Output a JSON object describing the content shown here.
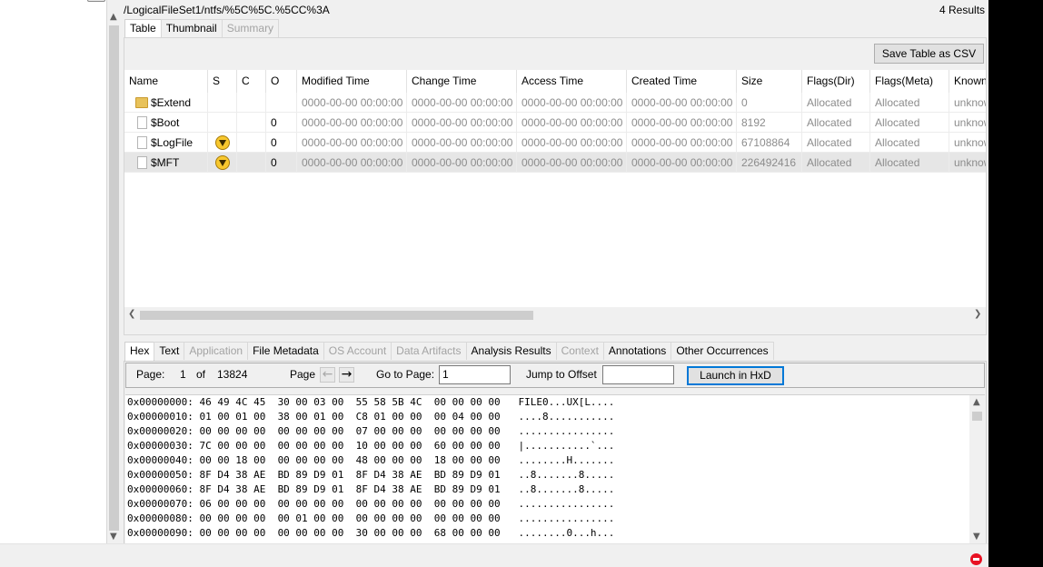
{
  "header": {
    "path": "/LogicalFileSet1/ntfs/%5C%5C.%5CC%3A",
    "results": "4  Results"
  },
  "result_tabs": [
    {
      "label": "Table",
      "state": "active"
    },
    {
      "label": "Thumbnail",
      "state": "normal"
    },
    {
      "label": "Summary",
      "state": "disabled"
    }
  ],
  "toolbar": {
    "save_csv_label": "Save Table as CSV"
  },
  "table": {
    "columns": [
      "Name",
      "S",
      "C",
      "O",
      "Modified Time",
      "Change Time",
      "Access Time",
      "Created Time",
      "Size",
      "Flags(Dir)",
      "Flags(Meta)",
      "Known"
    ],
    "rows": [
      {
        "name": "$Extend",
        "icon": "folder-icon",
        "s_icon": "",
        "c": "",
        "o": "",
        "modified": "0000-00-00 00:00:00",
        "change": "0000-00-00 00:00:00",
        "access": "0000-00-00 00:00:00",
        "created": "0000-00-00 00:00:00",
        "size": "0",
        "flags_dir": "Allocated",
        "flags_meta": "Allocated",
        "known": "unknown",
        "selected": false
      },
      {
        "name": "$Boot",
        "icon": "file-icon",
        "s_icon": "",
        "c": "",
        "o": "0",
        "modified": "0000-00-00 00:00:00",
        "change": "0000-00-00 00:00:00",
        "access": "0000-00-00 00:00:00",
        "created": "0000-00-00 00:00:00",
        "size": "8192",
        "flags_dir": "Allocated",
        "flags_meta": "Allocated",
        "known": "unknown",
        "selected": false
      },
      {
        "name": "$LogFile",
        "icon": "file-icon",
        "s_icon": "score-warning-icon",
        "c": "",
        "o": "0",
        "modified": "0000-00-00 00:00:00",
        "change": "0000-00-00 00:00:00",
        "access": "0000-00-00 00:00:00",
        "created": "0000-00-00 00:00:00",
        "size": "67108864",
        "flags_dir": "Allocated",
        "flags_meta": "Allocated",
        "known": "unknown",
        "selected": false
      },
      {
        "name": "$MFT",
        "icon": "file-icon",
        "s_icon": "score-warning-icon",
        "c": "",
        "o": "0",
        "modified": "0000-00-00 00:00:00",
        "change": "0000-00-00 00:00:00",
        "access": "0000-00-00 00:00:00",
        "created": "0000-00-00 00:00:00",
        "size": "226492416",
        "flags_dir": "Allocated",
        "flags_meta": "Allocated",
        "known": "unknown",
        "selected": true
      }
    ]
  },
  "content_tabs": [
    {
      "label": "Hex",
      "state": "active"
    },
    {
      "label": "Text",
      "state": "normal"
    },
    {
      "label": "Application",
      "state": "disabled"
    },
    {
      "label": "File Metadata",
      "state": "normal"
    },
    {
      "label": "OS Account",
      "state": "disabled"
    },
    {
      "label": "Data Artifacts",
      "state": "disabled"
    },
    {
      "label": "Analysis Results",
      "state": "normal"
    },
    {
      "label": "Context",
      "state": "disabled"
    },
    {
      "label": "Annotations",
      "state": "normal"
    },
    {
      "label": "Other Occurrences",
      "state": "normal"
    }
  ],
  "hex_toolbar": {
    "page_label": "Page:",
    "page_current": "1",
    "of_label": "of",
    "page_total": "13824",
    "page_nav_label": "Page",
    "goto_label": "Go to Page:",
    "goto_value": "1",
    "jump_label": "Jump to Offset",
    "jump_value": "",
    "launch_label": "Launch in HxD"
  },
  "hex_lines": [
    "0x00000000: 46 49 4C 45  30 00 03 00  55 58 5B 4C  00 00 00 00   FILE0...UX[L....",
    "0x00000010: 01 00 01 00  38 00 01 00  C8 01 00 00  00 04 00 00   ....8...........",
    "0x00000020: 00 00 00 00  00 00 00 00  07 00 00 00  00 00 00 00   ................",
    "0x00000030: 7C 00 00 00  00 00 00 00  10 00 00 00  60 00 00 00   |...........`...",
    "0x00000040: 00 00 18 00  00 00 00 00  48 00 00 00  18 00 00 00   ........H.......",
    "0x00000050: 8F D4 38 AE  BD 89 D9 01  8F D4 38 AE  BD 89 D9 01   ..8.......8.....",
    "0x00000060: 8F D4 38 AE  BD 89 D9 01  8F D4 38 AE  BD 89 D9 01   ..8.......8.....",
    "0x00000070: 06 00 00 00  00 00 00 00  00 00 00 00  00 00 00 00   ................",
    "0x00000080: 00 00 00 00  00 01 00 00  00 00 00 00  00 00 00 00   ................",
    "0x00000090: 00 00 00 00  00 00 00 00  30 00 00 00  68 00 00 00   ........0...h..."
  ]
}
